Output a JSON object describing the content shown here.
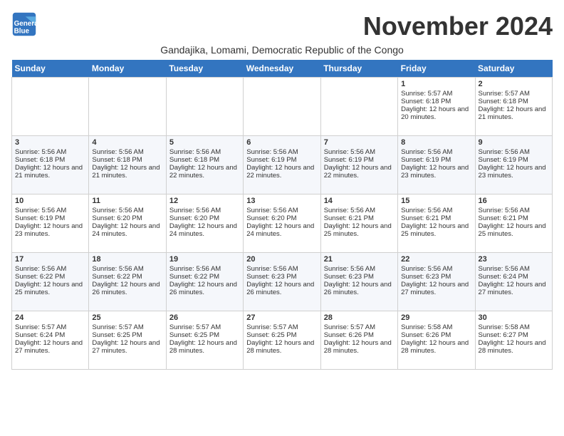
{
  "logo": {
    "line1": "General",
    "line2": "Blue"
  },
  "title": "November 2024",
  "subtitle": "Gandajika, Lomami, Democratic Republic of the Congo",
  "headers": [
    "Sunday",
    "Monday",
    "Tuesday",
    "Wednesday",
    "Thursday",
    "Friday",
    "Saturday"
  ],
  "weeks": [
    [
      {
        "day": "",
        "sunrise": "",
        "sunset": "",
        "daylight": ""
      },
      {
        "day": "",
        "sunrise": "",
        "sunset": "",
        "daylight": ""
      },
      {
        "day": "",
        "sunrise": "",
        "sunset": "",
        "daylight": ""
      },
      {
        "day": "",
        "sunrise": "",
        "sunset": "",
        "daylight": ""
      },
      {
        "day": "",
        "sunrise": "",
        "sunset": "",
        "daylight": ""
      },
      {
        "day": "1",
        "sunrise": "Sunrise: 5:57 AM",
        "sunset": "Sunset: 6:18 PM",
        "daylight": "Daylight: 12 hours and 20 minutes."
      },
      {
        "day": "2",
        "sunrise": "Sunrise: 5:57 AM",
        "sunset": "Sunset: 6:18 PM",
        "daylight": "Daylight: 12 hours and 21 minutes."
      }
    ],
    [
      {
        "day": "3",
        "sunrise": "Sunrise: 5:56 AM",
        "sunset": "Sunset: 6:18 PM",
        "daylight": "Daylight: 12 hours and 21 minutes."
      },
      {
        "day": "4",
        "sunrise": "Sunrise: 5:56 AM",
        "sunset": "Sunset: 6:18 PM",
        "daylight": "Daylight: 12 hours and 21 minutes."
      },
      {
        "day": "5",
        "sunrise": "Sunrise: 5:56 AM",
        "sunset": "Sunset: 6:18 PM",
        "daylight": "Daylight: 12 hours and 22 minutes."
      },
      {
        "day": "6",
        "sunrise": "Sunrise: 5:56 AM",
        "sunset": "Sunset: 6:19 PM",
        "daylight": "Daylight: 12 hours and 22 minutes."
      },
      {
        "day": "7",
        "sunrise": "Sunrise: 5:56 AM",
        "sunset": "Sunset: 6:19 PM",
        "daylight": "Daylight: 12 hours and 22 minutes."
      },
      {
        "day": "8",
        "sunrise": "Sunrise: 5:56 AM",
        "sunset": "Sunset: 6:19 PM",
        "daylight": "Daylight: 12 hours and 23 minutes."
      },
      {
        "day": "9",
        "sunrise": "Sunrise: 5:56 AM",
        "sunset": "Sunset: 6:19 PM",
        "daylight": "Daylight: 12 hours and 23 minutes."
      }
    ],
    [
      {
        "day": "10",
        "sunrise": "Sunrise: 5:56 AM",
        "sunset": "Sunset: 6:19 PM",
        "daylight": "Daylight: 12 hours and 23 minutes."
      },
      {
        "day": "11",
        "sunrise": "Sunrise: 5:56 AM",
        "sunset": "Sunset: 6:20 PM",
        "daylight": "Daylight: 12 hours and 24 minutes."
      },
      {
        "day": "12",
        "sunrise": "Sunrise: 5:56 AM",
        "sunset": "Sunset: 6:20 PM",
        "daylight": "Daylight: 12 hours and 24 minutes."
      },
      {
        "day": "13",
        "sunrise": "Sunrise: 5:56 AM",
        "sunset": "Sunset: 6:20 PM",
        "daylight": "Daylight: 12 hours and 24 minutes."
      },
      {
        "day": "14",
        "sunrise": "Sunrise: 5:56 AM",
        "sunset": "Sunset: 6:21 PM",
        "daylight": "Daylight: 12 hours and 25 minutes."
      },
      {
        "day": "15",
        "sunrise": "Sunrise: 5:56 AM",
        "sunset": "Sunset: 6:21 PM",
        "daylight": "Daylight: 12 hours and 25 minutes."
      },
      {
        "day": "16",
        "sunrise": "Sunrise: 5:56 AM",
        "sunset": "Sunset: 6:21 PM",
        "daylight": "Daylight: 12 hours and 25 minutes."
      }
    ],
    [
      {
        "day": "17",
        "sunrise": "Sunrise: 5:56 AM",
        "sunset": "Sunset: 6:22 PM",
        "daylight": "Daylight: 12 hours and 25 minutes."
      },
      {
        "day": "18",
        "sunrise": "Sunrise: 5:56 AM",
        "sunset": "Sunset: 6:22 PM",
        "daylight": "Daylight: 12 hours and 26 minutes."
      },
      {
        "day": "19",
        "sunrise": "Sunrise: 5:56 AM",
        "sunset": "Sunset: 6:22 PM",
        "daylight": "Daylight: 12 hours and 26 minutes."
      },
      {
        "day": "20",
        "sunrise": "Sunrise: 5:56 AM",
        "sunset": "Sunset: 6:23 PM",
        "daylight": "Daylight: 12 hours and 26 minutes."
      },
      {
        "day": "21",
        "sunrise": "Sunrise: 5:56 AM",
        "sunset": "Sunset: 6:23 PM",
        "daylight": "Daylight: 12 hours and 26 minutes."
      },
      {
        "day": "22",
        "sunrise": "Sunrise: 5:56 AM",
        "sunset": "Sunset: 6:23 PM",
        "daylight": "Daylight: 12 hours and 27 minutes."
      },
      {
        "day": "23",
        "sunrise": "Sunrise: 5:56 AM",
        "sunset": "Sunset: 6:24 PM",
        "daylight": "Daylight: 12 hours and 27 minutes."
      }
    ],
    [
      {
        "day": "24",
        "sunrise": "Sunrise: 5:57 AM",
        "sunset": "Sunset: 6:24 PM",
        "daylight": "Daylight: 12 hours and 27 minutes."
      },
      {
        "day": "25",
        "sunrise": "Sunrise: 5:57 AM",
        "sunset": "Sunset: 6:25 PM",
        "daylight": "Daylight: 12 hours and 27 minutes."
      },
      {
        "day": "26",
        "sunrise": "Sunrise: 5:57 AM",
        "sunset": "Sunset: 6:25 PM",
        "daylight": "Daylight: 12 hours and 28 minutes."
      },
      {
        "day": "27",
        "sunrise": "Sunrise: 5:57 AM",
        "sunset": "Sunset: 6:25 PM",
        "daylight": "Daylight: 12 hours and 28 minutes."
      },
      {
        "day": "28",
        "sunrise": "Sunrise: 5:57 AM",
        "sunset": "Sunset: 6:26 PM",
        "daylight": "Daylight: 12 hours and 28 minutes."
      },
      {
        "day": "29",
        "sunrise": "Sunrise: 5:58 AM",
        "sunset": "Sunset: 6:26 PM",
        "daylight": "Daylight: 12 hours and 28 minutes."
      },
      {
        "day": "30",
        "sunrise": "Sunrise: 5:58 AM",
        "sunset": "Sunset: 6:27 PM",
        "daylight": "Daylight: 12 hours and 28 minutes."
      }
    ]
  ]
}
